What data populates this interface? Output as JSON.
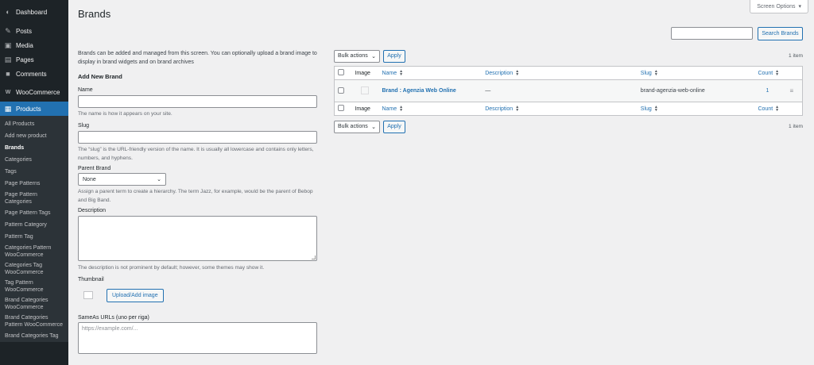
{
  "sidebar": {
    "top_items": [
      {
        "label": "Dashboard",
        "icon": "dashboard-icon"
      },
      {
        "label": "Posts",
        "icon": "pin-icon"
      },
      {
        "label": "Media",
        "icon": "media-icon"
      },
      {
        "label": "Pages",
        "icon": "pages-icon"
      },
      {
        "label": "Comments",
        "icon": "comments-icon"
      },
      {
        "label": "WooCommerce",
        "icon": "woocommerce-icon"
      },
      {
        "label": "Products",
        "icon": "products-icon"
      }
    ],
    "sub_items": [
      "All Products",
      "Add new product",
      "Brands",
      "Categories",
      "Tags",
      "Page Patterns",
      "Page Pattern Categories",
      "Page Pattern Tags",
      "Pattern Category",
      "Pattern Tag",
      "Categories Pattern WooCommerce",
      "Categories Tag WooCommerce",
      "Tag Pattern WooCommerce",
      "Brand Categories WooCommerce",
      "Brand Categories Pattern WooCommerce",
      "Brand Categories Tag"
    ]
  },
  "header": {
    "title": "Brands",
    "screen_options": "Screen Options"
  },
  "search": {
    "button": "Search Brands",
    "value": ""
  },
  "form": {
    "intro": "Brands can be added and managed from this screen. You can optionally upload a brand image to display in brand widgets and on brand archives",
    "heading": "Add New Brand",
    "name_label": "Name",
    "name_help": "The name is how it appears on your site.",
    "slug_label": "Slug",
    "slug_help": "The “slug” is the URL-friendly version of the name. It is usually all lowercase and contains only letters, numbers, and hyphens.",
    "parent_label": "Parent Brand",
    "parent_value": "None",
    "parent_help": "Assign a parent term to create a hierarchy. The term Jazz, for example, would be the parent of Bebop and Big Band.",
    "description_label": "Description",
    "description_help": "The description is not prominent by default; however, some themes may show it.",
    "thumbnail_label": "Thumbnail",
    "upload_button": "Upload/Add image",
    "sameas_label": "SameAs URLs (uno per riga)",
    "sameas_placeholder": "https://example.com/..."
  },
  "table": {
    "bulk_label": "Bulk actions",
    "apply_label": "Apply",
    "items_count": "1 item",
    "columns": {
      "image": "Image",
      "name": "Name",
      "description": "Description",
      "slug": "Slug",
      "count": "Count"
    },
    "rows": [
      {
        "name": "Brand : Agenzia Web Online",
        "description": "—",
        "slug": "brand-agenzia-web-online",
        "count": "1"
      }
    ]
  },
  "colors": {
    "sidebar_bg": "#1d2327",
    "accent": "#2271b1",
    "page_bg": "#f0f0f1"
  }
}
